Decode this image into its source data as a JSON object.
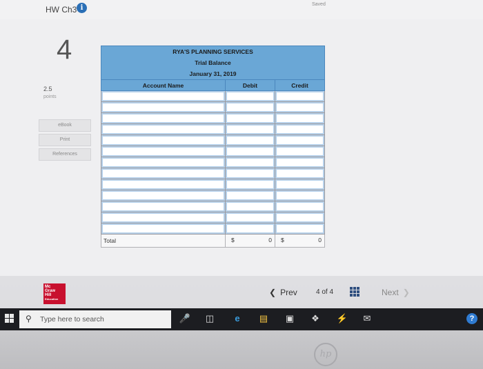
{
  "header": {
    "title": "HW Ch3",
    "info_icon": "i",
    "status": "Saved"
  },
  "question": {
    "number": "4",
    "points_value": "2.5",
    "points_label": "points",
    "buttons": [
      "eBook",
      "Print",
      "References"
    ]
  },
  "trial_balance": {
    "company": "RYA'S PLANNING SERVICES",
    "statement": "Trial Balance",
    "date": "January 31, 2019",
    "columns": [
      "Account Name",
      "Debit",
      "Credit"
    ],
    "total_label": "Total",
    "debit_currency": "$",
    "debit_total": "0",
    "credit_currency": "$",
    "credit_total": "0"
  },
  "footer": {
    "logo_lines": [
      "Mc",
      "Graw",
      "Hill",
      "Education"
    ],
    "prev_label": "Prev",
    "page_current": "4",
    "page_of": "of",
    "page_total": "4",
    "next_label": "Next"
  },
  "taskbar": {
    "search_placeholder": "Type here to search",
    "icons": [
      "microphone-icon",
      "task-view-icon",
      "edge-icon",
      "file-explorer-icon",
      "store-icon",
      "dropbox-icon",
      "power-app-icon",
      "mail-icon",
      "help-icon"
    ]
  },
  "bezel": {
    "brand": "hp"
  }
}
